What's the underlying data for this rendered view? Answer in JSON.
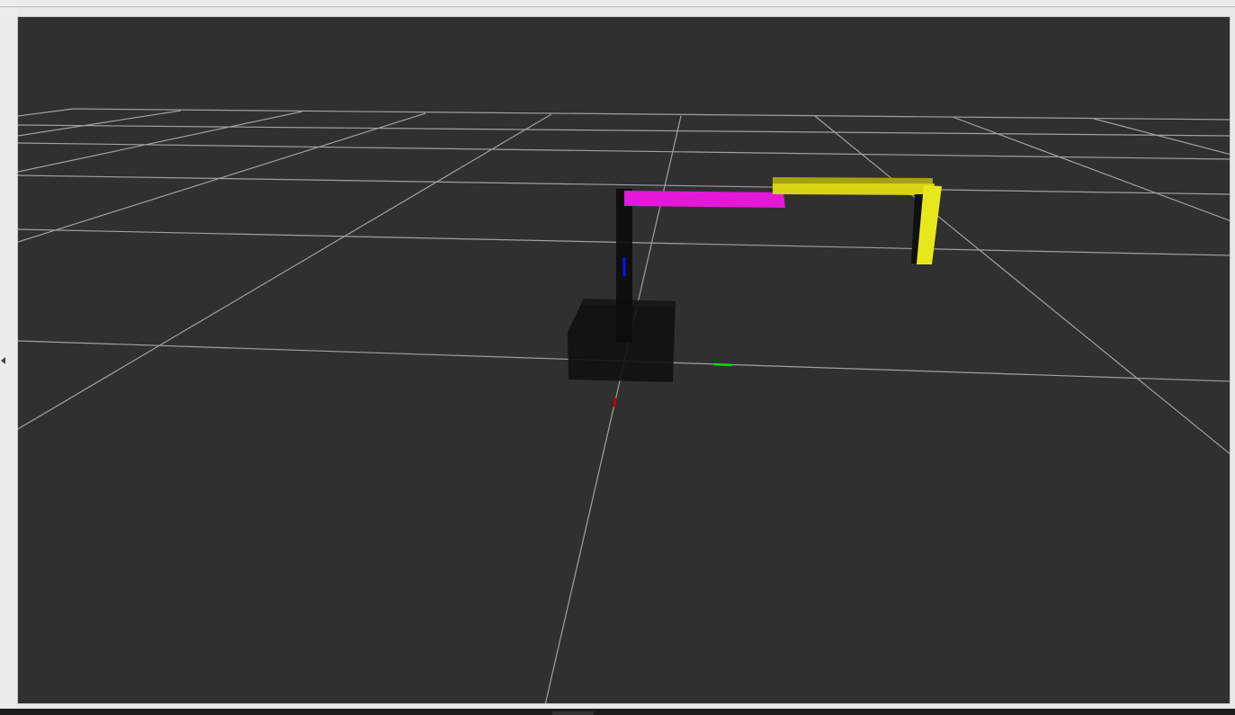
{
  "viewer": {
    "background_color": "#303030",
    "grid_color": "#a0a0a0",
    "grid_visible": true
  },
  "robot": {
    "base_color": "#111111",
    "upper_link_color": "#0c0c0c",
    "arm_link_1_color": "#e418d8",
    "arm_link_2_color": "#d7d414",
    "arm_link_3_color": "#e7e81c"
  },
  "axes": {
    "x_axis_color": "#cc0000",
    "y_axis_color": "#00dd00",
    "z_axis_color": "#1010ee"
  },
  "panel": {
    "collapse_icon": "caret-left-icon"
  }
}
